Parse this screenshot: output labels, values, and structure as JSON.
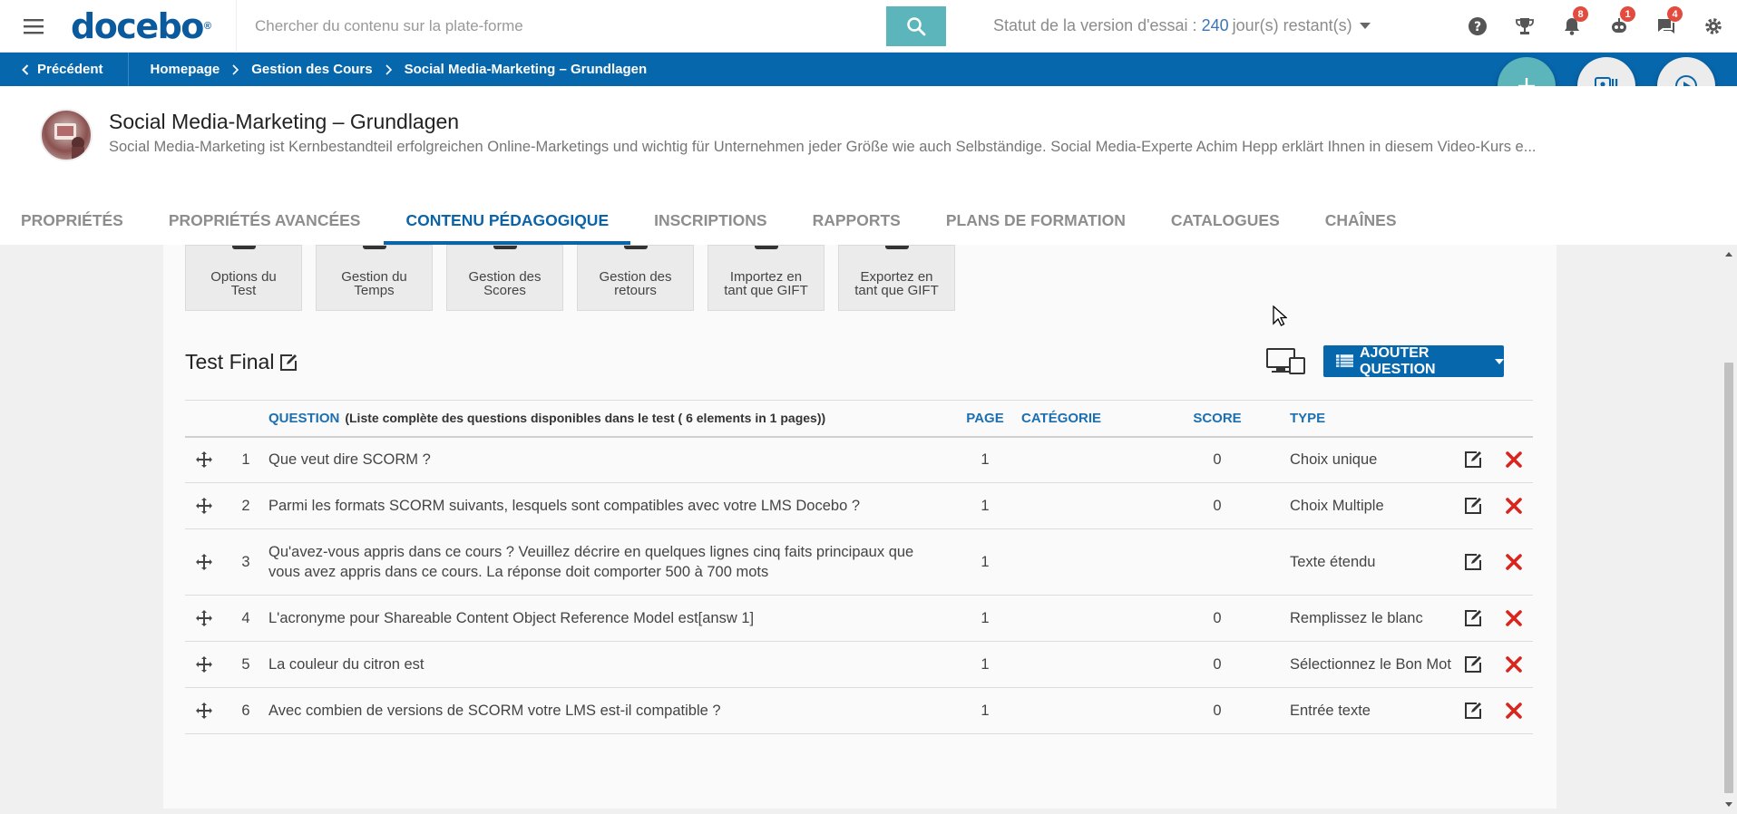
{
  "header": {
    "logo": "docebo",
    "logo_mark": "®",
    "search_placeholder": "Chercher du contenu sur la plate-forme",
    "trial_prefix": "Statut de la version d'essai :",
    "trial_days": "240",
    "trial_suffix": "jour(s) restant(s)",
    "notifications": {
      "gamification": "8",
      "bot": "1",
      "messages": "4"
    }
  },
  "breadcrumb": {
    "back": "Précédent",
    "items": [
      "Homepage",
      "Gestion des Cours",
      "Social Media-Marketing – Grundlagen"
    ]
  },
  "course": {
    "title": "Social Media-Marketing – Grundlagen",
    "description": "Social Media-Marketing ist Kernbestandteil erfolgreichen Online-Marketings und wichtig für Unternehmen jeder Größe wie auch Selbständige. Social Media-Experte Achim Hepp erklärt Ihnen in diesem Video-Kurs e..."
  },
  "tabs": [
    "PROPRIÉTÉS",
    "PROPRIÉTÉS AVANCÉES",
    "CONTENU PÉDAGOGIQUE",
    "INSCRIPTIONS",
    "RAPPORTS",
    "PLANS DE FORMATION",
    "CATALOGUES",
    "CHAÎNES"
  ],
  "active_tab": "CONTENU PÉDAGOGIQUE",
  "tools": [
    {
      "line1": "Options du",
      "line2": "Test"
    },
    {
      "line1": "Gestion du",
      "line2": "Temps"
    },
    {
      "line1": "Gestion des",
      "line2": "Scores"
    },
    {
      "line1": "Gestion des",
      "line2": "retours"
    },
    {
      "line1": "Importez en",
      "line2": "tant que GIFT"
    },
    {
      "line1": "Exportez en",
      "line2": "tant que GIFT"
    }
  ],
  "test": {
    "title": "Test Final",
    "add_question": "AJOUTER QUESTION"
  },
  "table": {
    "headers": {
      "question": "QUESTION",
      "question_sub": "(Liste complète des questions disponibles dans le test ( 6 elements in 1 pages))",
      "page": "PAGE",
      "category": "CATÉGORIE",
      "score": "SCORE",
      "type": "TYPE"
    },
    "rows": [
      {
        "num": "1",
        "question": "Que veut dire SCORM ?",
        "page": "1",
        "category": "",
        "score": "0",
        "type": "Choix unique"
      },
      {
        "num": "2",
        "question": "Parmi les formats SCORM suivants, lesquels sont compatibles avec votre LMS Docebo ?",
        "page": "1",
        "category": "",
        "score": "0",
        "type": "Choix Multiple"
      },
      {
        "num": "3",
        "question": "Qu'avez-vous appris dans ce cours ? Veuillez décrire en quelques lignes cinq faits principaux que vous avez appris dans ce cours. La réponse doit comporter 500 à 700 mots",
        "page": "1",
        "category": "",
        "score": "",
        "type": "Texte étendu"
      },
      {
        "num": "4",
        "question": "L'acronyme pour Shareable Content Object Reference Model est[answ 1]",
        "page": "1",
        "category": "",
        "score": "0",
        "type": "Remplissez le blanc"
      },
      {
        "num": "5",
        "question": "La couleur du citron est",
        "page": "1",
        "category": "",
        "score": "0",
        "type": "Sélectionnez le Bon Mot"
      },
      {
        "num": "6",
        "question": "Avec combien de versions de SCORM votre LMS est-il compatible ?",
        "page": "1",
        "category": "",
        "score": "0",
        "type": "Entrée texte"
      }
    ]
  },
  "colors": {
    "brand_blue": "#0767ad",
    "teal": "#5bb5ba",
    "delete_red": "#d9251c",
    "badge_red": "#e34b3e"
  },
  "icons": [
    "hamburger-icon",
    "search-icon",
    "help-icon",
    "trophy-icon",
    "bell-icon",
    "bot-icon",
    "chat-icon",
    "gear-icon",
    "plus-icon",
    "id-card-icon",
    "play-icon",
    "edit-icon",
    "move-icon",
    "delete-icon",
    "device-preview-icon",
    "list-icon"
  ]
}
